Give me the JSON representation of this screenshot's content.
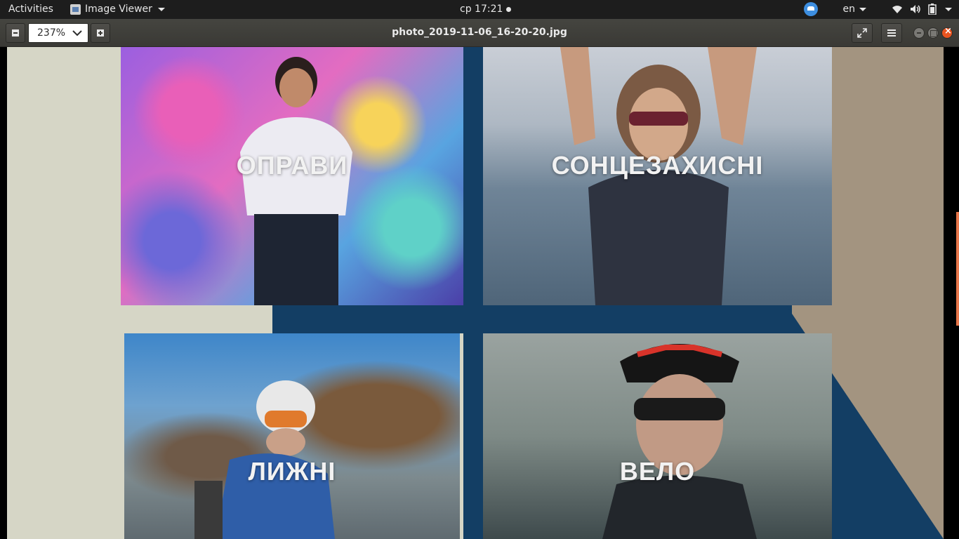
{
  "topbar": {
    "activities": "Activities",
    "app_name": "Image Viewer",
    "clock": "ср 17:21",
    "language": "en"
  },
  "toolbar": {
    "zoom_value": "237%",
    "file_title": "photo_2019-11-06_16-20-20.jpg"
  },
  "image": {
    "tiles": [
      {
        "label": "ОПРАВИ"
      },
      {
        "label": "СОНЦЕЗАХИСНІ"
      },
      {
        "label": "ЛИЖНІ"
      },
      {
        "label": "ВЕЛО"
      }
    ]
  },
  "colors": {
    "topbar_bg": "#1d1d1d",
    "headerbar_bg": "#3c3b37",
    "accent_close": "#e95420",
    "navy_band": "#133e64",
    "tan_band": "#a39480",
    "beige_bg": "#d6d6c6"
  }
}
